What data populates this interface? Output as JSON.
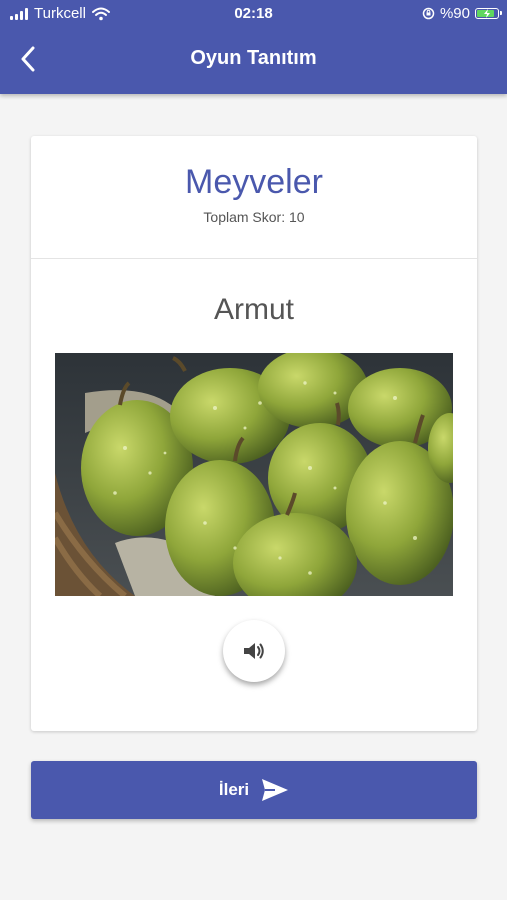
{
  "status_bar": {
    "carrier": "Turkcell",
    "time": "02:18",
    "battery": "%90",
    "battery_level": 0.9,
    "icons": [
      "signal-icon",
      "wifi-icon",
      "orientation-lock-icon",
      "battery-charging-icon"
    ]
  },
  "app_bar": {
    "title": "Oyun Tanıtım",
    "back_icon": "chevron-left-icon"
  },
  "card": {
    "category": "Meyveler",
    "score_text": "Toplam Skor: 10",
    "item_name": "Armut",
    "image_subject": "pears-photo",
    "sound_icon": "speaker-icon"
  },
  "next_button": {
    "label": "İleri",
    "icon": "send-icon"
  },
  "colors": {
    "primary": "#4a58ad",
    "background": "#f4f4f4",
    "card": "#ffffff"
  }
}
